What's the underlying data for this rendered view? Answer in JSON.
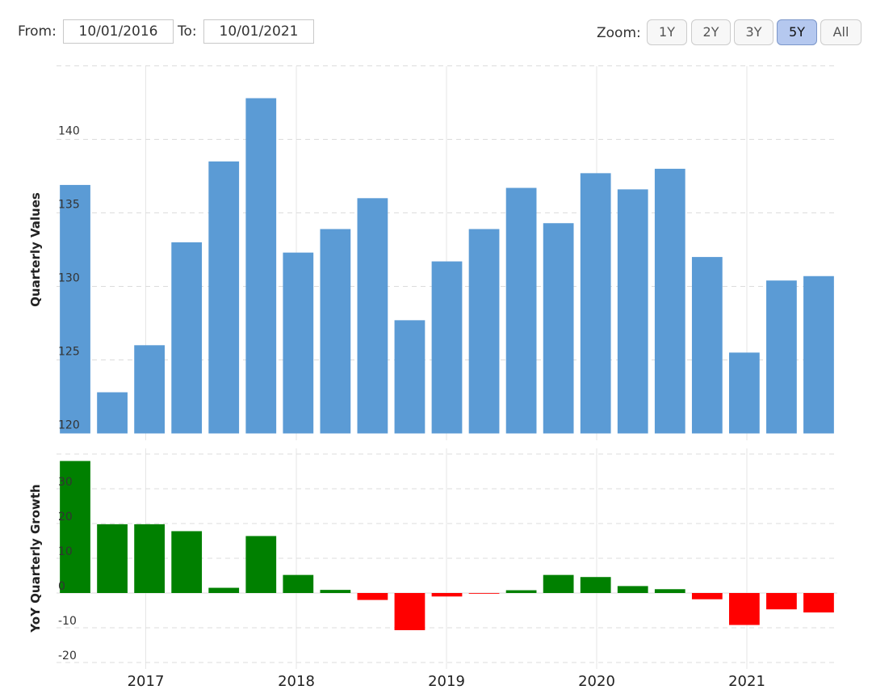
{
  "range_selector": {
    "from_label": "From:",
    "from_value": "10/01/2016",
    "to_label": "To:",
    "to_value": "10/01/2021",
    "zoom_label": "Zoom:",
    "zoom_options": [
      "1Y",
      "2Y",
      "3Y",
      "5Y",
      "All"
    ],
    "zoom_selected": "5Y"
  },
  "chart_data": [
    {
      "type": "bar",
      "ylabel": "Quarterly Values",
      "ylim": [
        120,
        145
      ],
      "yticks": [
        120,
        125,
        130,
        135,
        140
      ],
      "x_ticks": [
        "2017",
        "2018",
        "2019",
        "2020",
        "2021"
      ],
      "categories": [
        "2016-Q3",
        "2016-Q4",
        "2017-Q1",
        "2017-Q2",
        "2017-Q3",
        "2017-Q4",
        "2018-Q1",
        "2018-Q2",
        "2018-Q3",
        "2018-Q4",
        "2019-Q1",
        "2019-Q2",
        "2019-Q3",
        "2019-Q4",
        "2020-Q1",
        "2020-Q2",
        "2020-Q3",
        "2020-Q4",
        "2021-Q1",
        "2021-Q2",
        "2021-Q3"
      ],
      "values": [
        136.9,
        122.8,
        126.0,
        133.0,
        138.5,
        142.8,
        132.3,
        133.9,
        136.0,
        127.7,
        131.7,
        133.9,
        136.7,
        134.3,
        137.7,
        136.6,
        138.0,
        132.0,
        125.5,
        130.4,
        130.7
      ],
      "color": "#5b9bd5",
      "grid": true
    },
    {
      "type": "bar",
      "ylabel": "YoY Quarterly Growth",
      "ylim": [
        -22,
        40
      ],
      "yticks": [
        -20,
        -10,
        0,
        10,
        20,
        30
      ],
      "categories": [
        "2016-Q3",
        "2016-Q4",
        "2017-Q1",
        "2017-Q2",
        "2017-Q3",
        "2017-Q4",
        "2018-Q1",
        "2018-Q2",
        "2018-Q3",
        "2018-Q4",
        "2019-Q1",
        "2019-Q2",
        "2019-Q3",
        "2019-Q4",
        "2020-Q1",
        "2020-Q2",
        "2020-Q3",
        "2020-Q4",
        "2021-Q1",
        "2021-Q2",
        "2021-Q3"
      ],
      "values": [
        38.0,
        19.8,
        19.8,
        17.8,
        1.5,
        16.4,
        5.2,
        0.9,
        -2.0,
        -10.7,
        -1.0,
        -0.2,
        0.8,
        5.2,
        4.6,
        2.0,
        1.1,
        -1.8,
        -9.2,
        -4.7,
        -5.6
      ],
      "positive_color": "#008000",
      "negative_color": "#ff0000",
      "grid": true
    }
  ]
}
